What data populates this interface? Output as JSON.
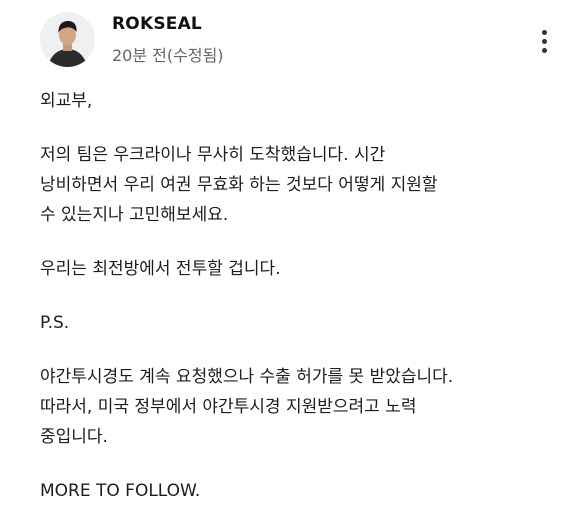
{
  "post": {
    "author": "ROKSEAL",
    "time": "20분 전(수정됨)",
    "paragraphs": [
      [
        "외교부,"
      ],
      [
        "저의 팀은 우크라이나 무사히 도착했습니다. 시간",
        "낭비하면서 우리 여권 무효화 하는 것보다 어떻게 지원할",
        "수 있는지나 고민해보세요."
      ],
      [
        "우리는 최전방에서 전투할 겁니다."
      ],
      [
        "P.S."
      ],
      [
        "야간투시경도 계속 요청했으나 수출 허가를 못 받았습니다.",
        "따라서, 미국 정부에서 야간투시경 지원받으려고 노력",
        "중입니다."
      ],
      [
        "MORE TO FOLLOW."
      ]
    ]
  },
  "icons": {
    "avatar": "profile-photo",
    "menu": "more-vertical-icon"
  }
}
